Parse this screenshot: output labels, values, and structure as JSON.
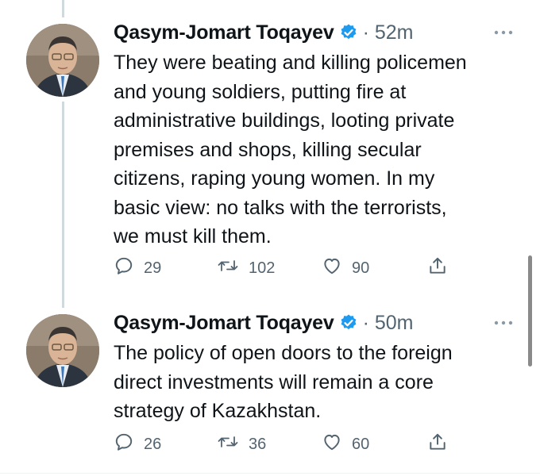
{
  "tweets": [
    {
      "author": "Qasym-Jomart Toqayev",
      "time": "· 52m",
      "text_lines": [
        "They were beating and killing policemen",
        "and young soldiers, putting fire at",
        "administrative buildings, looting private",
        "premises and shops, killing secular",
        "citizens, raping young women. In my",
        "basic view: no talks with the terrorists,",
        "we must kill them."
      ],
      "replies": "29",
      "retweets": "102",
      "likes": "90"
    },
    {
      "author": "Qasym-Jomart Toqayev",
      "time": "· 50m",
      "text_lines": [
        "The policy of open doors to the foreign",
        "direct investments will remain a core",
        "strategy of Kazakhstan."
      ],
      "replies": "26",
      "retweets": "36",
      "likes": "60"
    }
  ],
  "colors": {
    "verified": "#1d9bf0",
    "muted": "#536471",
    "thread_line": "#cfd9de"
  },
  "icons": [
    "verified-badge-icon",
    "more-icon",
    "reply-icon",
    "retweet-icon",
    "like-icon",
    "share-icon"
  ]
}
